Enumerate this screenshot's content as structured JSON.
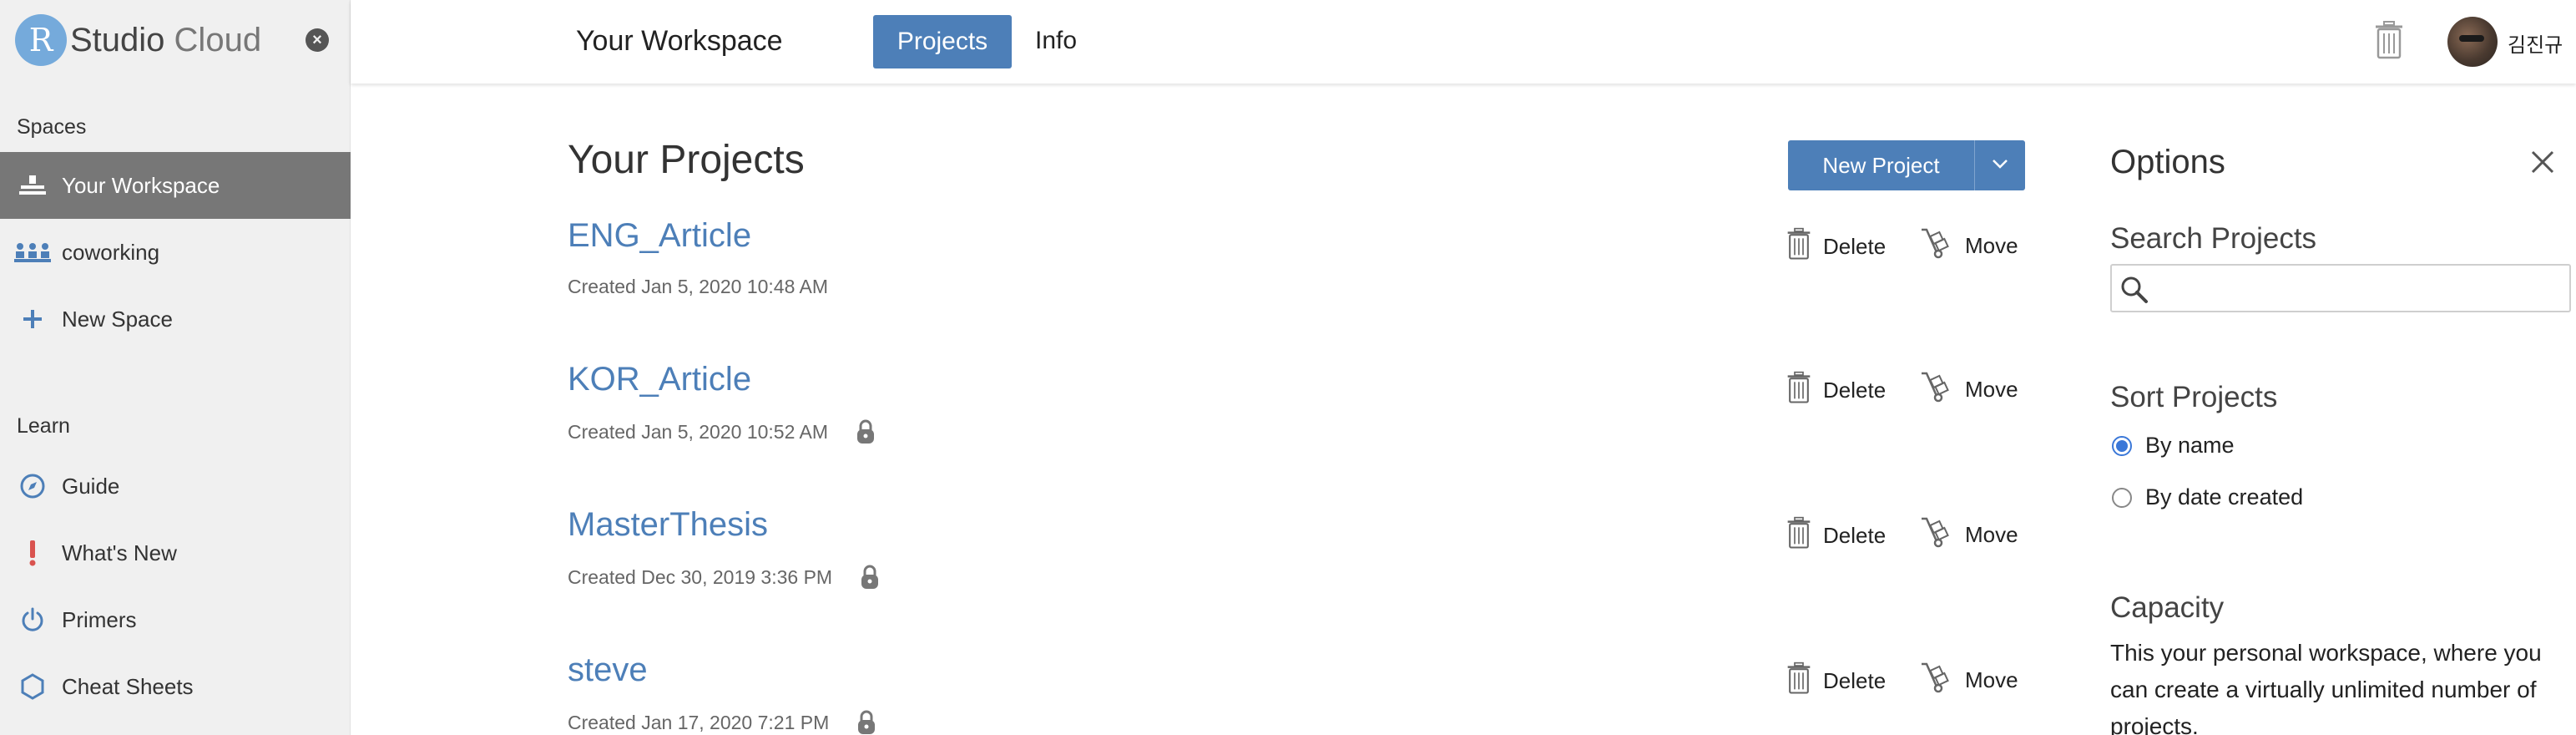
{
  "sidebar": {
    "logo_r": "R",
    "logo_bold": "Studio",
    "logo_light": "Cloud",
    "close_glyph": "×",
    "spaces_heading": "Spaces",
    "spaces": [
      {
        "label": "Your Workspace",
        "icon": "workspace-icon",
        "active": true
      },
      {
        "label": "coworking",
        "icon": "people-icon",
        "active": false
      },
      {
        "label": "New Space",
        "icon": "plus-icon",
        "active": false
      }
    ],
    "learn_heading": "Learn",
    "learn": [
      {
        "label": "Guide",
        "icon": "compass-icon"
      },
      {
        "label": "What's New",
        "icon": "exclamation-icon"
      },
      {
        "label": "Primers",
        "icon": "power-icon"
      },
      {
        "label": "Cheat Sheets",
        "icon": "hexagon-icon"
      }
    ]
  },
  "header": {
    "title": "Your Workspace",
    "tabs": [
      {
        "label": "Projects",
        "active": true
      },
      {
        "label": "Info",
        "active": false
      }
    ],
    "user_name": "김진규"
  },
  "main": {
    "title": "Your Projects",
    "new_project_label": "New Project",
    "delete_label": "Delete",
    "move_label": "Move",
    "projects": [
      {
        "name": "ENG_Article",
        "created": "Created Jan 5, 2020 10:48 AM",
        "locked": false
      },
      {
        "name": "KOR_Article",
        "created": "Created Jan 5, 2020 10:52 AM",
        "locked": true
      },
      {
        "name": "MasterThesis",
        "created": "Created Dec 30, 2019 3:36 PM",
        "locked": true
      },
      {
        "name": "steve",
        "created": "Created Jan 17, 2020 7:21 PM",
        "locked": true
      }
    ]
  },
  "options": {
    "title": "Options",
    "search_heading": "Search Projects",
    "search_value": "",
    "search_placeholder": "",
    "sort_heading": "Sort Projects",
    "sort_options": [
      {
        "label": "By name",
        "checked": true
      },
      {
        "label": "By date created",
        "checked": false
      }
    ],
    "capacity_heading": "Capacity",
    "capacity_text": "This your personal workspace, where you can create a virtually unlimited number of projects."
  },
  "colors": {
    "accent": "#4d7fb8",
    "logo_blue": "#75aadb",
    "sidebar_bg": "#f0f0f0",
    "active_item_bg": "#777777",
    "whats_new_red": "#d9534f"
  }
}
